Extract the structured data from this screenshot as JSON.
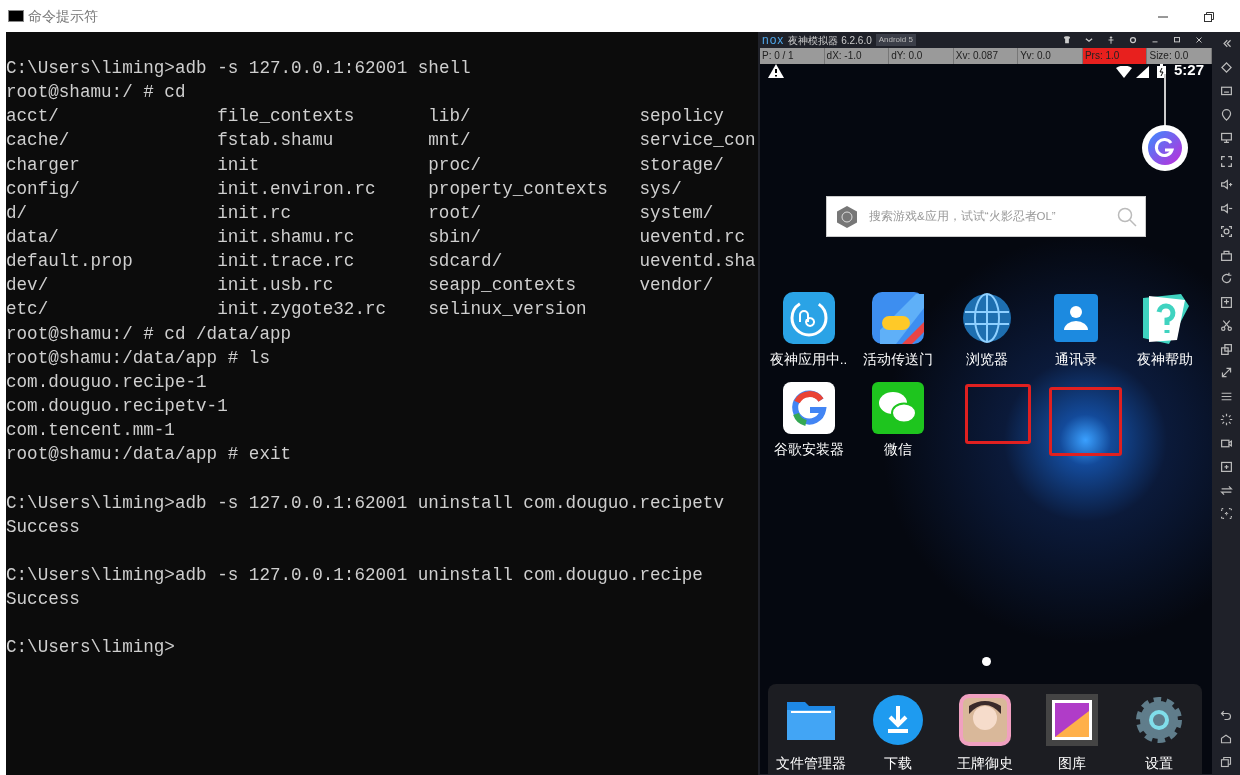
{
  "window": {
    "title": "命令提示符"
  },
  "terminal": {
    "lines": [
      {
        "kind": "text",
        "text": "C:\\Users\\liming>adb -s 127.0.0.1:62001 shell"
      },
      {
        "kind": "text",
        "text": "root@shamu:/ # cd"
      },
      {
        "kind": "columns",
        "cells": [
          "acct/",
          "file_contexts",
          "lib/",
          "sepolicy"
        ]
      },
      {
        "kind": "columns",
        "cells": [
          "cache/",
          "fstab.shamu",
          "mnt/",
          "service_con"
        ]
      },
      {
        "kind": "columns",
        "cells": [
          "charger",
          "init",
          "proc/",
          "storage/"
        ]
      },
      {
        "kind": "columns",
        "cells": [
          "config/",
          "init.environ.rc",
          "property_contexts",
          "sys/"
        ]
      },
      {
        "kind": "columns",
        "cells": [
          "d/",
          "init.rc",
          "root/",
          "system/"
        ]
      },
      {
        "kind": "columns",
        "cells": [
          "data/",
          "init.shamu.rc",
          "sbin/",
          "ueventd.rc"
        ]
      },
      {
        "kind": "columns",
        "cells": [
          "default.prop",
          "init.trace.rc",
          "sdcard/",
          "ueventd.sha"
        ]
      },
      {
        "kind": "columns",
        "cells": [
          "dev/",
          "init.usb.rc",
          "seapp_contexts",
          "vendor/"
        ]
      },
      {
        "kind": "columns",
        "cells": [
          "etc/",
          "init.zygote32.rc",
          "selinux_version"
        ]
      },
      {
        "kind": "text",
        "text": "root@shamu:/ # cd /data/app"
      },
      {
        "kind": "text",
        "text": "root@shamu:/data/app # ls"
      },
      {
        "kind": "text",
        "text": "com.douguo.recipe-1"
      },
      {
        "kind": "text",
        "text": "com.douguo.recipetv-1"
      },
      {
        "kind": "text",
        "text": "com.tencent.mm-1"
      },
      {
        "kind": "text",
        "text": "root@shamu:/data/app # exit"
      },
      {
        "kind": "blank"
      },
      {
        "kind": "text",
        "text": "C:\\Users\\liming>adb -s 127.0.0.1:62001 uninstall com.douguo.recipetv"
      },
      {
        "kind": "text",
        "text": "Success"
      },
      {
        "kind": "blank"
      },
      {
        "kind": "text",
        "text": "C:\\Users\\liming>adb -s 127.0.0.1:62001 uninstall com.douguo.recipe"
      },
      {
        "kind": "text",
        "text": "Success"
      },
      {
        "kind": "blank"
      },
      {
        "kind": "text",
        "text": "C:\\Users\\liming>"
      }
    ]
  },
  "emulator": {
    "logo": "nox",
    "title": "夜神模拟器 6.2.6.0",
    "version_badge": "Android 5",
    "pointer_bar": [
      {
        "text": "P: 0 / 1",
        "highlighted": false
      },
      {
        "text": "dX: -1.0",
        "highlighted": false
      },
      {
        "text": "dY: 0.0",
        "highlighted": false
      },
      {
        "text": "Xv: 0.087",
        "highlighted": false
      },
      {
        "text": "Yv: 0.0",
        "highlighted": false
      },
      {
        "text": "Prs: 1.0",
        "highlighted": true
      },
      {
        "text": "Size: 0.0",
        "highlighted": false
      }
    ],
    "status_time": "5:27",
    "search": {
      "placeholder": "搜索游戏&应用，试试“火影忍者OL”"
    },
    "apps": [
      {
        "label": "夜神应用中.."
      },
      {
        "label": "活动传送门"
      },
      {
        "label": "浏览器"
      },
      {
        "label": "通讯录"
      },
      {
        "label": "夜神帮助"
      },
      {
        "label": "谷歌安装器"
      },
      {
        "label": "微信"
      }
    ],
    "page_dots": [
      {
        "selected": true
      }
    ],
    "dock": [
      {
        "label": "文件管理器"
      },
      {
        "label": "下载"
      },
      {
        "label": "王牌御史"
      },
      {
        "label": "图库"
      },
      {
        "label": "设置"
      }
    ]
  }
}
